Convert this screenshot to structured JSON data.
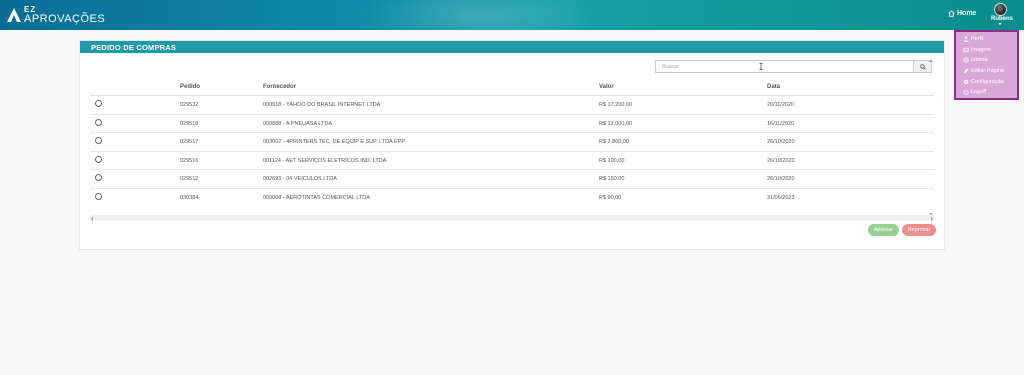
{
  "brand": {
    "top": "EZ",
    "bottom": "APROVAÇÕES"
  },
  "header": {
    "home_label": "Home",
    "user_name": "Rubens"
  },
  "user_menu": [
    {
      "label": "Perfil",
      "icon": "user-icon"
    },
    {
      "label": "Imagem",
      "icon": "image-icon"
    },
    {
      "label": "Idioma",
      "icon": "globe-icon"
    },
    {
      "label": "Editar Página",
      "icon": "pencil-icon"
    },
    {
      "label": "Configuração",
      "icon": "gear-icon"
    },
    {
      "label": "Logoff",
      "icon": "power-icon"
    }
  ],
  "panel": {
    "title": "PEDIDO DE COMPRAS"
  },
  "search": {
    "placeholder": "Buscar",
    "value": ""
  },
  "table": {
    "columns": [
      "Pedido",
      "Fornecedor",
      "Valor",
      "Data"
    ],
    "rows": [
      {
        "pedido": "029532",
        "fornecedor": "000918 - YAHOO DO BRASIL INTERNET LTDA",
        "valor": "R$ 17.200,00",
        "data": "20/11/2020"
      },
      {
        "pedido": "029518",
        "fornecedor": "000888 - A PNEUASA LTDA",
        "valor": "R$ 12.000,00",
        "data": "16/11/2020"
      },
      {
        "pedido": "029517",
        "fornecedor": "003002 - 4PRINTERS TEC. DE EQUIP E SUP. LTDA EPP",
        "valor": "R$ 2.800,00",
        "data": "26/10/2020"
      },
      {
        "pedido": "029516",
        "fornecedor": "001124 - AET SERVICOS ELETRICOS IND. LTDA",
        "valor": "R$ 100,00",
        "data": "26/10/2020"
      },
      {
        "pedido": "029512",
        "fornecedor": "002693 - 04 VEICULOS LTDA",
        "valor": "R$ 150,00",
        "data": "26/10/2020"
      },
      {
        "pedido": "030384",
        "fornecedor": "000008 - AEROTINTAS COMERCIAL LTDA",
        "valor": "R$ 90,00",
        "data": "31/05/2023"
      }
    ]
  },
  "actions": {
    "approve_label": "Aprovar",
    "reject_label": "Reprovar"
  },
  "colors": {
    "header_teal": "#17a0a9",
    "panel_head": "#1e9aa8",
    "approve": "#96d095",
    "reject": "#ee8f8f",
    "menu_bg": "#d9a8d9",
    "menu_border": "#8c2e8c"
  }
}
